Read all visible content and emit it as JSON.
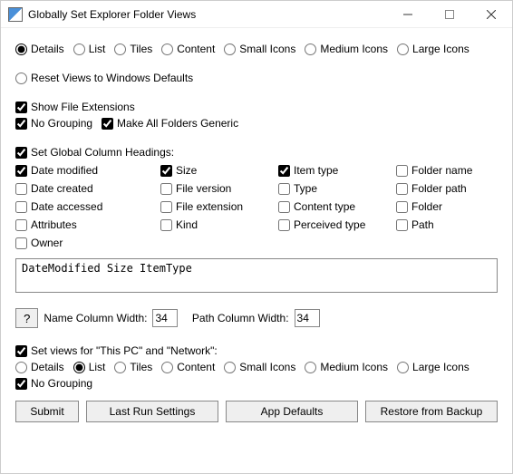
{
  "window": {
    "title": "Globally Set Explorer Folder Views"
  },
  "views": {
    "options": [
      "Details",
      "List",
      "Tiles",
      "Content",
      "Small Icons",
      "Medium Icons",
      "Large Icons"
    ],
    "selected": "Details"
  },
  "reset": {
    "label": "Reset Views to Windows Defaults",
    "checked": false
  },
  "extensions": {
    "label": "Show File Extensions",
    "checked": true
  },
  "nogrouping": {
    "label": "No Grouping",
    "checked": true
  },
  "generic": {
    "label": "Make All Folders Generic",
    "checked": true
  },
  "globalcols": {
    "label": "Set Global Column Headings:",
    "checked": true
  },
  "columns": [
    {
      "label": "Date modified",
      "checked": true
    },
    {
      "label": "Size",
      "checked": true
    },
    {
      "label": "Item type",
      "checked": true
    },
    {
      "label": "Folder name",
      "checked": false
    },
    {
      "label": "Date created",
      "checked": false
    },
    {
      "label": "File version",
      "checked": false
    },
    {
      "label": "Type",
      "checked": false
    },
    {
      "label": "Folder path",
      "checked": false
    },
    {
      "label": "Date accessed",
      "checked": false
    },
    {
      "label": "File extension",
      "checked": false
    },
    {
      "label": "Content type",
      "checked": false
    },
    {
      "label": "Folder",
      "checked": false
    },
    {
      "label": "Attributes",
      "checked": false
    },
    {
      "label": "Kind",
      "checked": false
    },
    {
      "label": "Perceived type",
      "checked": false
    },
    {
      "label": "Path",
      "checked": false
    },
    {
      "label": "Owner",
      "checked": false
    }
  ],
  "colstring": "DateModified Size ItemType",
  "help": {
    "label": "?"
  },
  "widths": {
    "name_label": "Name Column Width:",
    "name_value": "34",
    "path_label": "Path Column Width:",
    "path_value": "34"
  },
  "thispc": {
    "toggle_label": "Set views for \"This PC\" and \"Network\":",
    "toggle_checked": true,
    "options": [
      "Details",
      "List",
      "Tiles",
      "Content",
      "Small Icons",
      "Medium Icons",
      "Large Icons"
    ],
    "selected": "List",
    "nogrouping_label": "No Grouping",
    "nogrouping_checked": true
  },
  "footer": {
    "submit": "Submit",
    "lastrun": "Last Run Settings",
    "defaults": "App Defaults",
    "restore": "Restore from Backup"
  }
}
